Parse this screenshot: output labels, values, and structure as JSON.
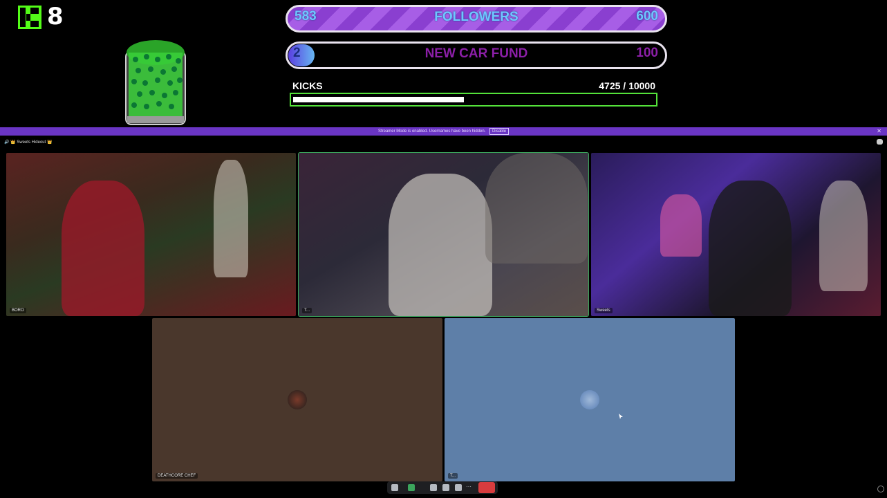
{
  "overlay": {
    "kick_count": "8",
    "followers_goal": {
      "current": "583",
      "label": "FOLLOWERS",
      "target": "600"
    },
    "car_goal": {
      "current": "2",
      "label": "NEW CAR FUND",
      "target": "100"
    },
    "kicks": {
      "label": "KICKS",
      "value": "4725  / 10000",
      "progress": 0.4725
    }
  },
  "discord": {
    "notice_text": "Streamer Mode is enabled. Usernames have been hidden.",
    "notice_button": "Disable",
    "server_title": "🔊 👑 Sweets Hideout 👑",
    "tiles": [
      {
        "name": "BORO"
      },
      {
        "name": "T..."
      },
      {
        "name": "Sweets"
      },
      {
        "name": "DEATHCORE CHEF"
      },
      {
        "name": "T..."
      }
    ]
  },
  "colors": {
    "accent_green": "#54e23a",
    "discord_purple": "#6a35c4",
    "hangup_red": "#d83c3e"
  }
}
